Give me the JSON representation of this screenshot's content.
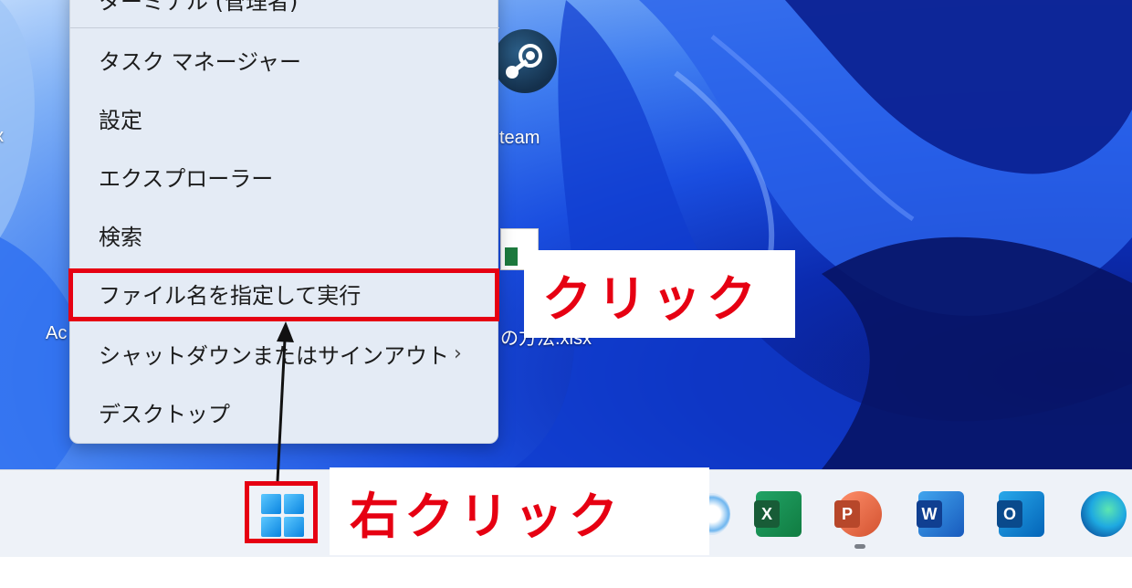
{
  "menu": {
    "items": [
      {
        "label": "ターミナル (管理者)"
      },
      {
        "label": "タスク マネージャー"
      },
      {
        "label": "設定"
      },
      {
        "label": "エクスプローラー"
      },
      {
        "label": "検索"
      },
      {
        "label": "ファイル名を指定して実行"
      },
      {
        "label": "シャットダウンまたはサインアウト",
        "submenu_chevron": "›"
      },
      {
        "label": "デスクトップ"
      }
    ]
  },
  "annotations": {
    "click_label": "クリック",
    "right_click_label": "右クリック",
    "highlight_color": "#e60012"
  },
  "desktop": {
    "steam_label": "team",
    "left_label": "x",
    "ac_label": "Ac",
    "xlsx_label": "の方法.xlsx"
  },
  "taskbar": {
    "apps": [
      {
        "name": "partial-app"
      },
      {
        "name": "Excel",
        "letter": "X"
      },
      {
        "name": "PowerPoint",
        "letter": "P"
      },
      {
        "name": "Word",
        "letter": "W"
      },
      {
        "name": "Outlook",
        "letter": "O"
      },
      {
        "name": "Edge"
      }
    ]
  }
}
